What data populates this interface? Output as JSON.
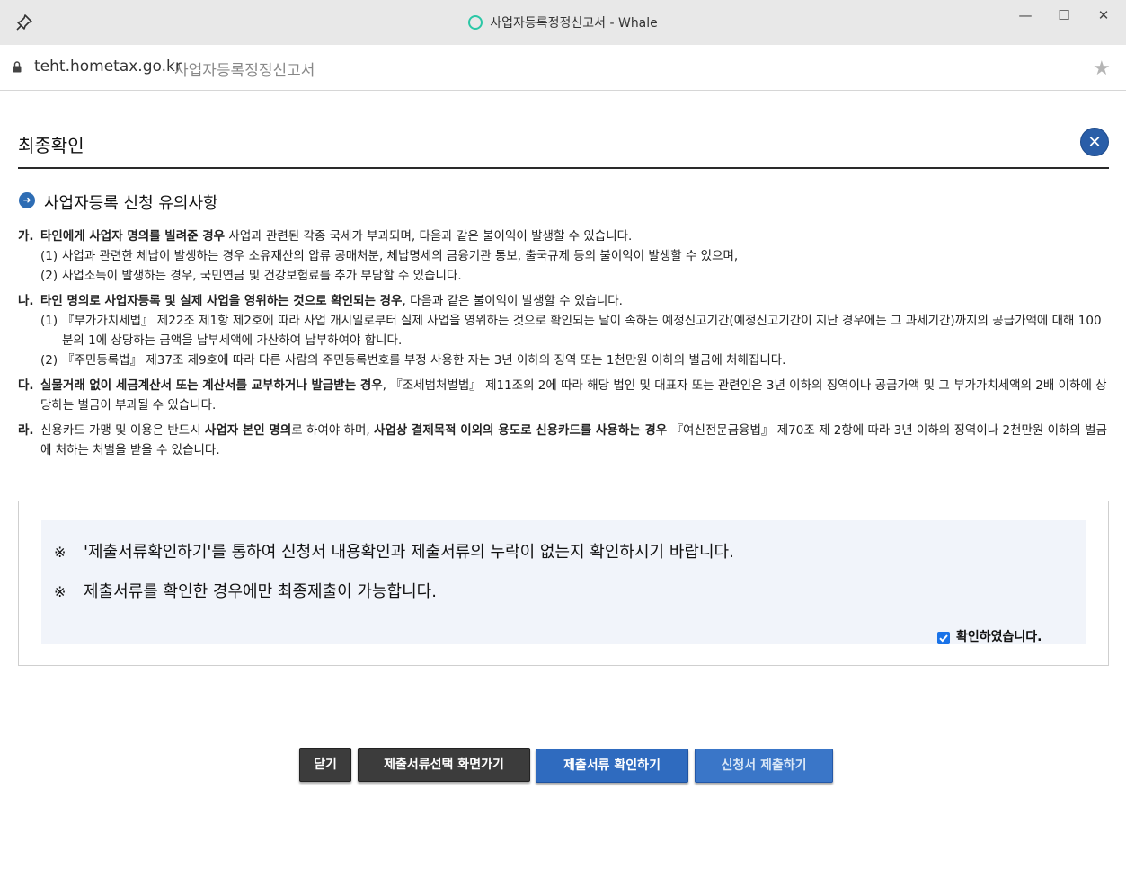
{
  "window": {
    "title": "사업자등록정정신고서 - Whale",
    "minimize_glyph": "—",
    "maximize_glyph": "☐",
    "close_glyph": "✕"
  },
  "address": {
    "host": "teht.hometax.go.kr",
    "page_title": "사업자등록정정신고서",
    "star_glyph": "★"
  },
  "header": {
    "title": "최종확인",
    "close_glyph": "✕"
  },
  "section": {
    "title": "사업자등록 신청 유의사항",
    "icon_glyph": "➜"
  },
  "notices": {
    "ga": {
      "marker": "가.",
      "bold": "타인에게 사업자 명의를 빌려준 경우",
      "text": " 사업과 관련된 각종 국세가 부과되며, 다음과 같은 불이익이 발생할 수 있습니다.",
      "sub1_mark": "(1)",
      "sub1": "사업과 관련한 체납이 발생하는 경우 소유재산의 압류 공매처분, 체납명세의 금융기관 통보, 출국규제 등의 불이익이 발생할 수 있으며,",
      "sub2_mark": "(2)",
      "sub2": "사업소득이 발생하는 경우, 국민연금 및 건강보험료를 추가 부담할 수 있습니다."
    },
    "na": {
      "marker": "나.",
      "bold": "타인 명의로 사업자등록 및 실제 사업을 영위하는 것으로 확인되는 경우",
      "text": ", 다음과 같은 불이익이 발생할 수 있습니다.",
      "sub1_mark": "(1)",
      "sub1": "『부가가치세법』 제22조 제1항 제2호에 따라 사업 개시일로부터 실제 사업을 영위하는 것으로 확인되는 날이 속하는 예정신고기간(예정신고기간이 지난 경우에는 그 과세기간)까지의 공급가액에 대해 100분의 1에 상당하는 금액을 납부세액에 가산하여 납부하여야 합니다.",
      "sub2_mark": "(2)",
      "sub2": "『주민등록법』 제37조 제9호에 따라 다른 사람의 주민등록번호를 부정 사용한 자는 3년 이하의 징역 또는 1천만원 이하의 벌금에 처해집니다."
    },
    "da": {
      "marker": "다.",
      "bold": "실물거래 없이 세금계산서 또는 계산서를 교부하거나 발급받는 경우",
      "text": ", 『조세범처벌법』 제11조의 2에 따라 해당 법인 및 대표자 또는 관련인은 3년 이하의 징역이나 공급가액 및 그 부가가치세액의 2배 이하에 상당하는 벌금이 부과될 수 있습니다."
    },
    "ra": {
      "marker": "라.",
      "text1": "신용카드 가맹 및 이용은 반드시 ",
      "bold1": "사업자 본인 명의",
      "text2": "로 하여야 하며, ",
      "bold2": "사업상 결제목적 이외의 용도로 신용카드를 사용하는 경우",
      "text3": " 『여신전문금융법』 제70조 제 2항에 따라 3년 이하의 징역이나 2천만원 이하의 벌금에 처하는 처벌을 받을 수 있습니다."
    }
  },
  "confirm": {
    "ref_mark": "※",
    "line1": "'제출서류확인하기'를 통하여 신청서 내용확인과 제출서류의 누락이 없는지 확인하시기 바랍니다.",
    "line2": "제출서류를 확인한 경우에만 최종제출이 가능합니다.",
    "checkbox_label": "확인하였습니다.",
    "checked": true
  },
  "buttons": {
    "close": "닫기",
    "goto_select": "제출서류선택 화면가기",
    "check_docs": "제출서류 확인하기",
    "submit": "신청서 제출하기"
  },
  "colors": {
    "accent": "#2a5ea8",
    "dark_button": "#3c3c3c",
    "blue_button": "#2f6bbf"
  }
}
